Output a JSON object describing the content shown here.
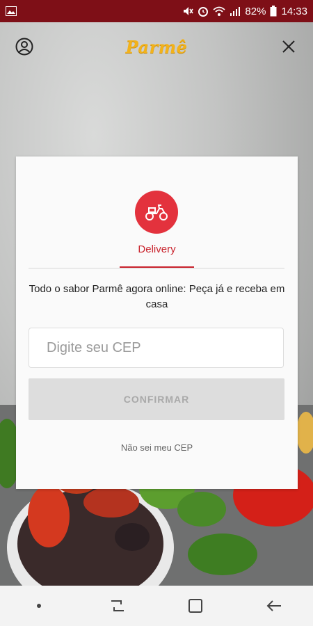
{
  "status_bar": {
    "battery_percent": "82%",
    "time": "14:33",
    "icons": [
      "gallery-icon",
      "mute-icon",
      "alarm-icon",
      "wifi-icon",
      "signal-icon",
      "battery-icon"
    ]
  },
  "header": {
    "logo_text": "Parmê",
    "icons": [
      "profile-icon",
      "close-icon"
    ]
  },
  "card": {
    "mode_icon": "scooter-icon",
    "mode_label": "Delivery",
    "promo_text": "Todo o sabor Parmê agora online: Peça já e receba em casa",
    "cep_placeholder": "Digite seu CEP",
    "cep_value": "",
    "confirm_label": "CONFIRMAR",
    "no_cep_link": "Não sei meu CEP"
  },
  "nav_bar": {
    "icons": [
      "dot-icon",
      "recent-apps-icon",
      "home-icon",
      "back-icon"
    ]
  },
  "colors": {
    "status_bar": "#7e0f17",
    "brand_red": "#e3323d",
    "logo_yellow": "#f2b21a",
    "button_disabled": "#dddddd"
  }
}
